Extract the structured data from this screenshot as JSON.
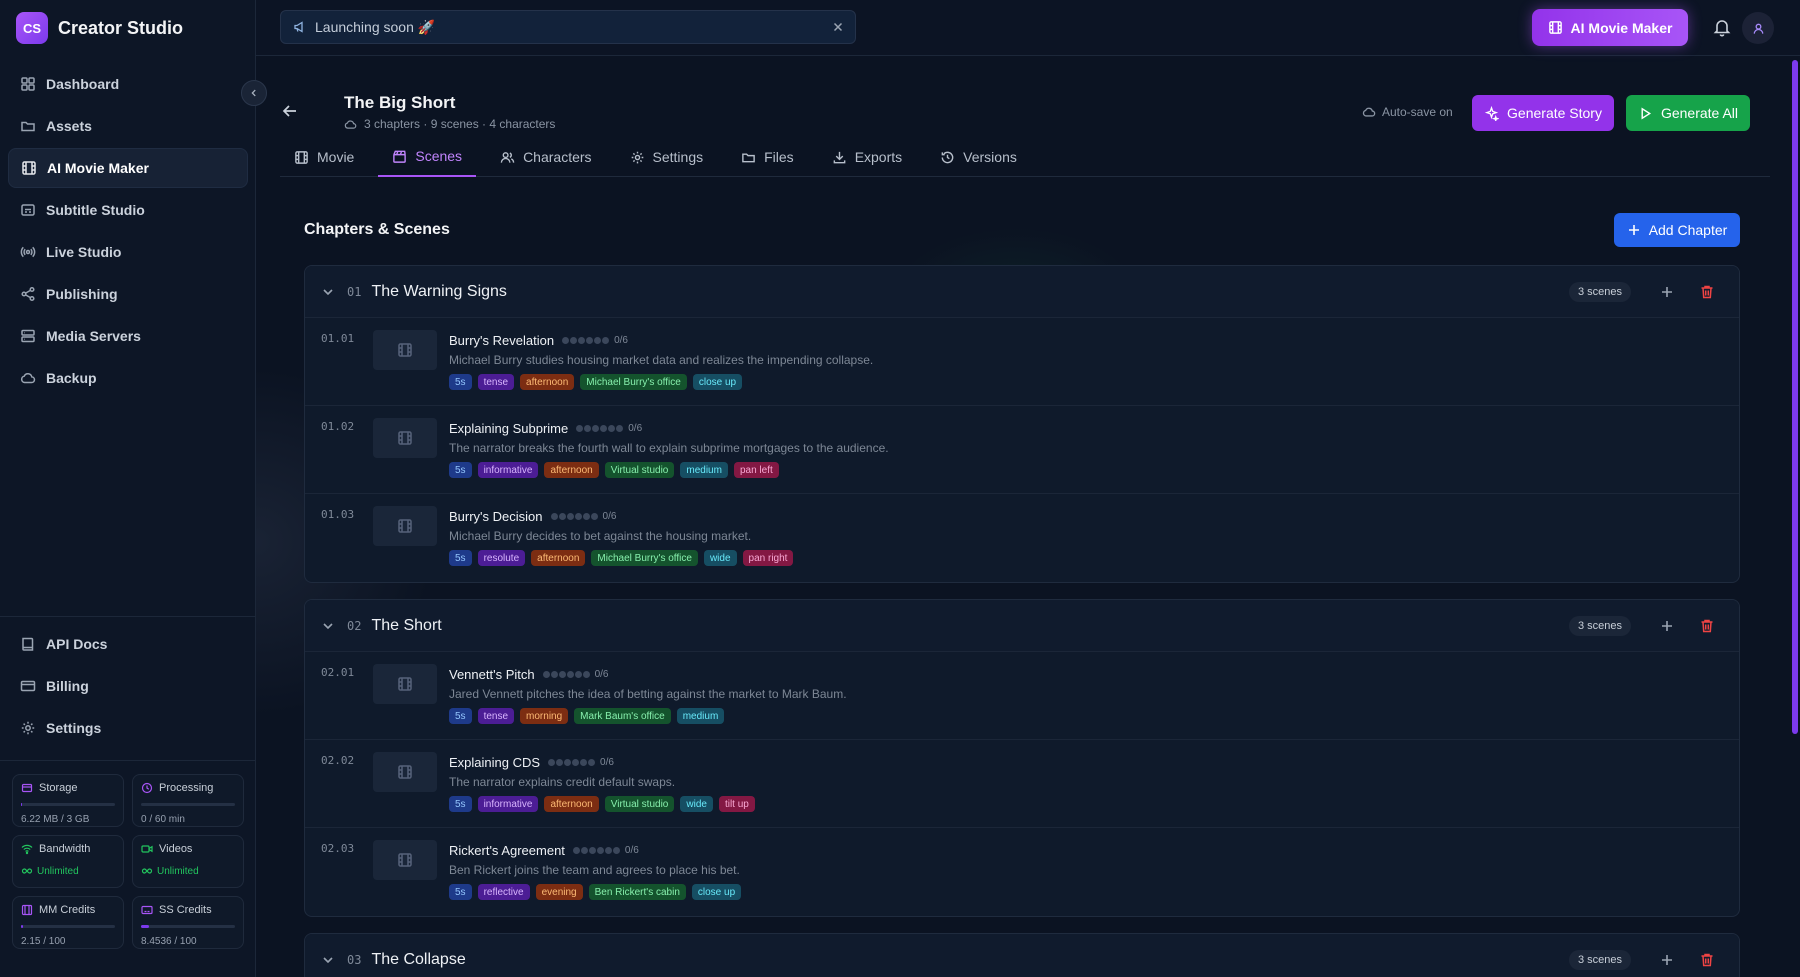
{
  "app": {
    "logo": "CS",
    "name": "Creator Studio"
  },
  "sidebar": {
    "items": [
      {
        "label": "Dashboard",
        "icon": "grid-icon"
      },
      {
        "label": "Assets",
        "icon": "folder-icon"
      },
      {
        "label": "AI Movie Maker",
        "icon": "film-icon",
        "active": true
      },
      {
        "label": "Subtitle Studio",
        "icon": "captions-icon"
      },
      {
        "label": "Live Studio",
        "icon": "radio-icon"
      },
      {
        "label": "Publishing",
        "icon": "share-icon"
      },
      {
        "label": "Media Servers",
        "icon": "server-icon"
      },
      {
        "label": "Backup",
        "icon": "cloud-icon"
      }
    ],
    "bottom_items": [
      {
        "label": "API Docs",
        "icon": "book-icon"
      },
      {
        "label": "Billing",
        "icon": "credit-card-icon"
      },
      {
        "label": "Settings",
        "icon": "gear-icon"
      }
    ],
    "stats": {
      "storage": {
        "label": "Storage",
        "value": "6.22 MB / 3 GB",
        "fill": 0.002
      },
      "processing": {
        "label": "Processing",
        "value": "0 / 60 min",
        "fill": 0
      },
      "bandwidth": {
        "label": "Bandwidth",
        "value": "Unlimited"
      },
      "videos": {
        "label": "Videos",
        "value": "Unlimited"
      },
      "mm_credits": {
        "label": "MM Credits",
        "value": "2.15 / 100",
        "fill": 0.0215
      },
      "ss_credits": {
        "label": "SS Credits",
        "value": "8.4536 / 100",
        "fill": 0.0845
      }
    }
  },
  "topbar": {
    "announcement": "Launching soon 🚀",
    "ai_button": "AI Movie Maker"
  },
  "project": {
    "title": "The Big Short",
    "meta": "3 chapters · 9 scenes · 4 characters",
    "autosave": "Auto-save on",
    "generate_story": "Generate Story",
    "generate_all": "Generate All"
  },
  "tabs": [
    {
      "label": "Movie",
      "icon": "film-icon"
    },
    {
      "label": "Scenes",
      "icon": "clapperboard-icon",
      "active": true
    },
    {
      "label": "Characters",
      "icon": "users-icon"
    },
    {
      "label": "Settings",
      "icon": "gear-icon"
    },
    {
      "label": "Files",
      "icon": "folder-icon"
    },
    {
      "label": "Exports",
      "icon": "download-icon"
    },
    {
      "label": "Versions",
      "icon": "history-icon"
    }
  ],
  "section": {
    "title": "Chapters & Scenes",
    "add_chapter": "Add Chapter"
  },
  "colors": {
    "accent": "#a855f7",
    "primary": "#2563eb",
    "success": "#16a34a",
    "danger": "#ef4444"
  },
  "chapters": [
    {
      "num": "01",
      "title": "The Warning Signs",
      "count": "3 scenes",
      "scenes": [
        {
          "num": "01.01",
          "title": "Burry's Revelation",
          "progress": "0/6",
          "desc": "Michael Burry studies housing market data and realizes the impending collapse.",
          "tags": [
            [
              "5s",
              "dur"
            ],
            [
              "tense",
              "mood"
            ],
            [
              "afternoon",
              "time"
            ],
            [
              "Michael Burry's office",
              "loc"
            ],
            [
              "close up",
              "shot"
            ]
          ]
        },
        {
          "num": "01.02",
          "title": "Explaining Subprime",
          "progress": "0/6",
          "desc": "The narrator breaks the fourth wall to explain subprime mortgages to the audience.",
          "tags": [
            [
              "5s",
              "dur"
            ],
            [
              "informative",
              "mood"
            ],
            [
              "afternoon",
              "time"
            ],
            [
              "Virtual studio",
              "loc"
            ],
            [
              "medium",
              "shot"
            ],
            [
              "pan left",
              "cam"
            ]
          ]
        },
        {
          "num": "01.03",
          "title": "Burry's Decision",
          "progress": "0/6",
          "desc": "Michael Burry decides to bet against the housing market.",
          "tags": [
            [
              "5s",
              "dur"
            ],
            [
              "resolute",
              "mood"
            ],
            [
              "afternoon",
              "time"
            ],
            [
              "Michael Burry's office",
              "loc"
            ],
            [
              "wide",
              "shot"
            ],
            [
              "pan right",
              "cam"
            ]
          ]
        }
      ]
    },
    {
      "num": "02",
      "title": "The Short",
      "count": "3 scenes",
      "scenes": [
        {
          "num": "02.01",
          "title": "Vennett's Pitch",
          "progress": "0/6",
          "desc": "Jared Vennett pitches the idea of betting against the market to Mark Baum.",
          "tags": [
            [
              "5s",
              "dur"
            ],
            [
              "tense",
              "mood"
            ],
            [
              "morning",
              "time"
            ],
            [
              "Mark Baum's office",
              "loc"
            ],
            [
              "medium",
              "shot"
            ]
          ]
        },
        {
          "num": "02.02",
          "title": "Explaining CDS",
          "progress": "0/6",
          "desc": "The narrator explains credit default swaps.",
          "tags": [
            [
              "5s",
              "dur"
            ],
            [
              "informative",
              "mood"
            ],
            [
              "afternoon",
              "time"
            ],
            [
              "Virtual studio",
              "loc"
            ],
            [
              "wide",
              "shot"
            ],
            [
              "tilt up",
              "cam"
            ]
          ]
        },
        {
          "num": "02.03",
          "title": "Rickert's Agreement",
          "progress": "0/6",
          "desc": "Ben Rickert joins the team and agrees to place his bet.",
          "tags": [
            [
              "5s",
              "dur"
            ],
            [
              "reflective",
              "mood"
            ],
            [
              "evening",
              "time"
            ],
            [
              "Ben Rickert's cabin",
              "loc"
            ],
            [
              "close up",
              "shot"
            ]
          ]
        }
      ]
    },
    {
      "num": "03",
      "title": "The Collapse",
      "count": "3 scenes",
      "scenes": []
    }
  ]
}
